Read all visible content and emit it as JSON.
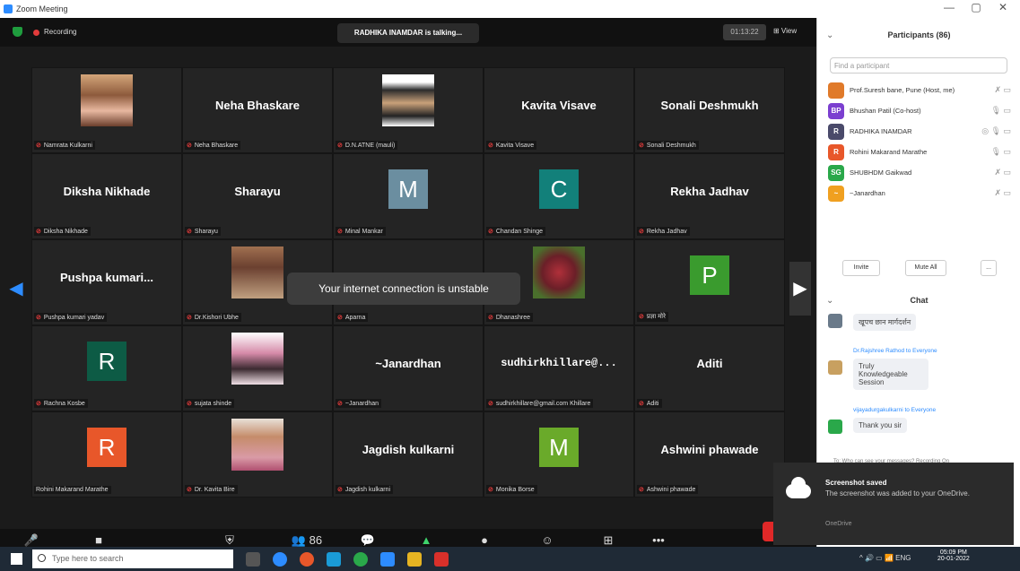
{
  "window": {
    "title": "Zoom Meeting",
    "minimize": "—",
    "maximize": "▢",
    "close": "✕"
  },
  "topbar": {
    "recording": "Recording",
    "talking": "RADHIKA INAMDAR is talking...",
    "pager": "01:13:22",
    "view": "⊞ View"
  },
  "toast": "Your internet connection is unstable",
  "tiles": [
    {
      "label": "Namrata Kulkarni",
      "display": "",
      "kind": "photo",
      "photo": "woman"
    },
    {
      "label": "Neha Bhaskare",
      "display": "Neha Bhaskare",
      "kind": "name"
    },
    {
      "label": "D.N.ATNE (mauli)",
      "display": "",
      "kind": "photo",
      "photo": "man"
    },
    {
      "label": "Kavita Visave",
      "display": "Kavita Visave",
      "kind": "name"
    },
    {
      "label": "Sonali Deshmukh",
      "display": "Sonali Deshmukh",
      "kind": "name"
    },
    {
      "label": "Diksha Nikhade",
      "display": "Diksha Nikhade",
      "kind": "name"
    },
    {
      "label": "Sharayu",
      "display": "Sharayu",
      "kind": "name"
    },
    {
      "label": "Minal Mankar",
      "display": "M",
      "kind": "avatar",
      "color": "#6b8ea0"
    },
    {
      "label": "Chandan Shinge",
      "display": "C",
      "kind": "avatar",
      "color": "#12807a"
    },
    {
      "label": "Rekha Jadhav",
      "display": "Rekha Jadhav",
      "kind": "name"
    },
    {
      "label": "Pushpa kumari yadav",
      "display": "Pushpa kumari...",
      "kind": "name"
    },
    {
      "label": "Dr.Kishori Ubhe",
      "display": "",
      "kind": "photo",
      "photo": "girl"
    },
    {
      "label": "Aparna",
      "display": "",
      "kind": "blank"
    },
    {
      "label": "Dhanashree",
      "display": "",
      "kind": "photo",
      "photo": "flower"
    },
    {
      "label": "प्रज्ञा मोरे",
      "display": "P",
      "kind": "avatar",
      "color": "#3a9b2e"
    },
    {
      "label": "Rachna Kosbe",
      "display": "R",
      "kind": "avatar",
      "color": "#0d5b45"
    },
    {
      "label": "sujata shinde",
      "display": "",
      "kind": "photo",
      "photo": "sari"
    },
    {
      "label": "~Janardhan",
      "display": "~Janardhan",
      "kind": "name"
    },
    {
      "label": "sudhirkhillare@gmail.com Khillare",
      "display": "sudhirkhillare@...",
      "kind": "name",
      "code": true
    },
    {
      "label": "Aditi",
      "display": "Aditi",
      "kind": "name"
    },
    {
      "label": "Rohini Makarand Marathe",
      "display": "R",
      "kind": "avatar",
      "color": "#e8572a",
      "nomic": true
    },
    {
      "label": "Dr. Kavita Bire",
      "display": "",
      "kind": "photo",
      "photo": "lady"
    },
    {
      "label": "Jagdish kulkarni",
      "display": "Jagdish kulkarni",
      "kind": "name"
    },
    {
      "label": "Monika Borse",
      "display": "M",
      "kind": "avatar",
      "color": "#6aaa2a"
    },
    {
      "label": "Ashwini phawade",
      "display": "Ashwini phawade",
      "kind": "name"
    }
  ],
  "toolbar": [
    {
      "name": "unmute",
      "icon": "🎤",
      "label": "Unmute"
    },
    {
      "name": "stop-video",
      "icon": "■",
      "label": "Stop Video"
    },
    {
      "name": "security",
      "icon": "⛨",
      "label": "Security"
    },
    {
      "name": "participants",
      "icon": "👥 86",
      "label": "Participants"
    },
    {
      "name": "chat",
      "icon": "💬",
      "label": "Chat"
    },
    {
      "name": "share-screen",
      "icon": "▲",
      "label": "Share Screen"
    },
    {
      "name": "record",
      "icon": "●",
      "label": "Record"
    },
    {
      "name": "reactions",
      "icon": "☺",
      "label": "Reactions"
    },
    {
      "name": "apps",
      "icon": "⊞",
      "label": "Apps"
    },
    {
      "name": "more",
      "icon": "•••",
      "label": "More"
    }
  ],
  "participants": {
    "title": "Participants (86)",
    "search_placeholder": "Find a participant",
    "items": [
      {
        "name": "Prof.Suresh bane, Pune (Host, me)",
        "initials": "",
        "color": "#e07a2a",
        "icons": "✗ ▭"
      },
      {
        "name": "Bhushan Patil (Co-host)",
        "initials": "BP",
        "color": "#7b3fd0",
        "icons": "🎙 ▭"
      },
      {
        "name": "RADHIKA INAMDAR",
        "initials": "R",
        "color": "#4a4a6a",
        "icons": "◎ 🎙 ▭"
      },
      {
        "name": "Rohini Makarand Marathe",
        "initials": "R",
        "color": "#e8572a",
        "icons": "🎙 ▭"
      },
      {
        "name": "SHUBHDM Gaikwad",
        "initials": "SG",
        "color": "#2aa84a",
        "icons": "✗ ▭"
      },
      {
        "name": "~Janardhan",
        "initials": "~",
        "color": "#f0a020",
        "icons": "✗ ▭"
      }
    ],
    "invite": "Invite",
    "mute_all": "Mute All",
    "more": "..."
  },
  "chat": {
    "title": "Chat",
    "messages": [
      {
        "sender": "",
        "text": "खूपच छान मार्गदर्शन",
        "color": "#6a7a8a"
      },
      {
        "sender": "Dr.Rajshree Rathod to Everyone",
        "text": "Truly Knowledgeable Session",
        "color": "#c8a060"
      },
      {
        "sender": "vijayadurgakulkarni to Everyone",
        "text": "Thank you sir",
        "color": "#2aa84a"
      }
    ],
    "footer": "To: Who can see your messages? Recording On"
  },
  "notification": {
    "title": "Screenshot saved",
    "body": "The screenshot was added to your OneDrive.",
    "source": "OneDrive"
  },
  "taskbar": {
    "search_placeholder": "Type here to search",
    "time": "05:09 PM",
    "date": "20-01-2022",
    "lang": "ENG"
  }
}
